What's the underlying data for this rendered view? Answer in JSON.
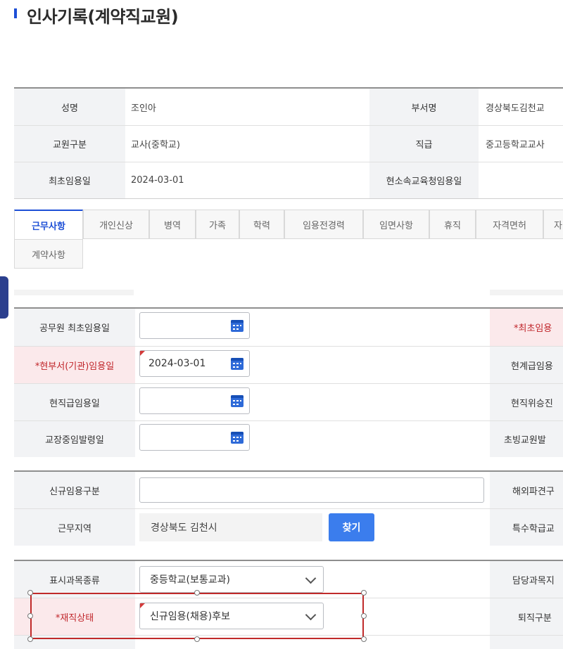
{
  "page_title": "인사기록(계약직교원)",
  "summary": {
    "name_label": "성명",
    "name_value": "조인아",
    "dept_label": "부서명",
    "dept_value": "경상북도김천교",
    "type_label": "교원구분",
    "type_value": "교사(중학교)",
    "grade_label": "직급",
    "grade_value": "중고등학교교사",
    "first_date_label": "최초임용일",
    "first_date_value": "2024-03-01",
    "office_date_label": "현소속교육청임용일",
    "office_date_value": ""
  },
  "tabs": [
    "근무사항",
    "개인신상",
    "병역",
    "가족",
    "학력",
    "임용전경력",
    "임면사항",
    "휴직",
    "자격면허",
    "자",
    "계약사항"
  ],
  "section1": {
    "r1_label": "공무원 최초임용일",
    "r1_value": "",
    "r1_right_label": "*최초임용",
    "r2_label": "*현부서(기관)임용일",
    "r2_value": "2024-03-01",
    "r2_right_label": "현계급임용",
    "r3_label": "현직급임용일",
    "r3_value": "",
    "r3_right_label": "현직위승진",
    "r4_label": "교장중임발령일",
    "r4_value": "",
    "r4_right_label": "초빙교원발"
  },
  "section2": {
    "r1_label": "신규임용구분",
    "r1_value": "",
    "r1_right_label": "해외파견구",
    "r2_label": "근무지역",
    "r2_value": "경상북도 김천시",
    "find_button": "찾기",
    "r2_right_label": "특수학급교"
  },
  "section3": {
    "r1_label": "표시과목종류",
    "r1_value": "중등학교(보통교과)",
    "r1_right_label": "담당과목지",
    "r2_label": "*재직상태",
    "r2_value": "신규임용(채용)후보",
    "r2_right_label": "퇴직구분"
  },
  "colors": {
    "accent": "#1d4fd6",
    "required": "#c0252a",
    "button": "#3b7ded"
  }
}
